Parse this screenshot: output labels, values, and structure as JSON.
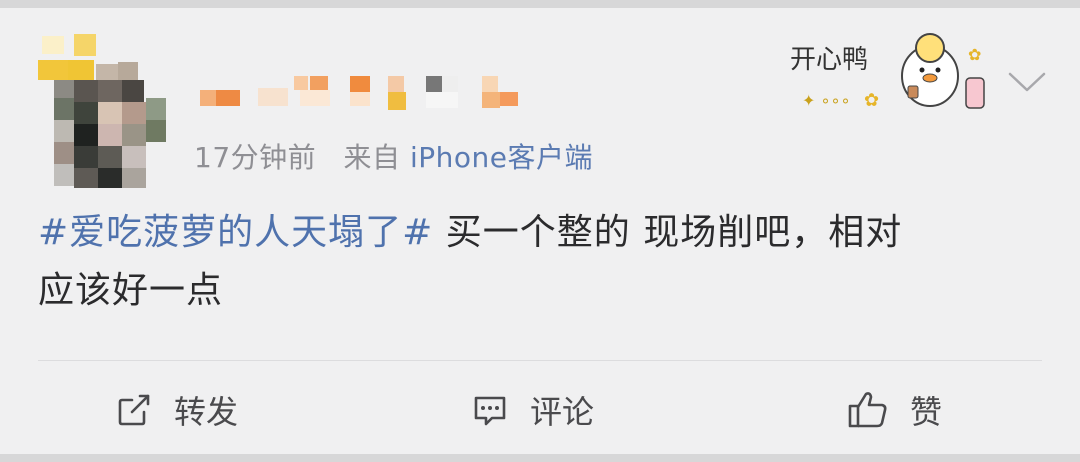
{
  "post": {
    "time": "17分钟前",
    "source_prefix": "来自",
    "source_device": "iPhone客户端",
    "topic": "#爱吃菠萝的人天塌了#",
    "body_line1": " 买一个整的 现场削吧，相对",
    "body_line2": "应该好一点"
  },
  "sticker": {
    "text": "开心鸭"
  },
  "actions": {
    "repost_label": "转发",
    "comment_label": "评论",
    "like_label": "赞"
  },
  "icons": {
    "more": "chevron-down-icon",
    "repost": "share-icon",
    "comment": "comment-icon",
    "like": "thumbs-up-icon"
  },
  "colors": {
    "topic_link": "#4f72ad",
    "source_link": "#5b7bb2",
    "text_primary": "#2b2b2d",
    "text_secondary": "#8f8f94"
  }
}
